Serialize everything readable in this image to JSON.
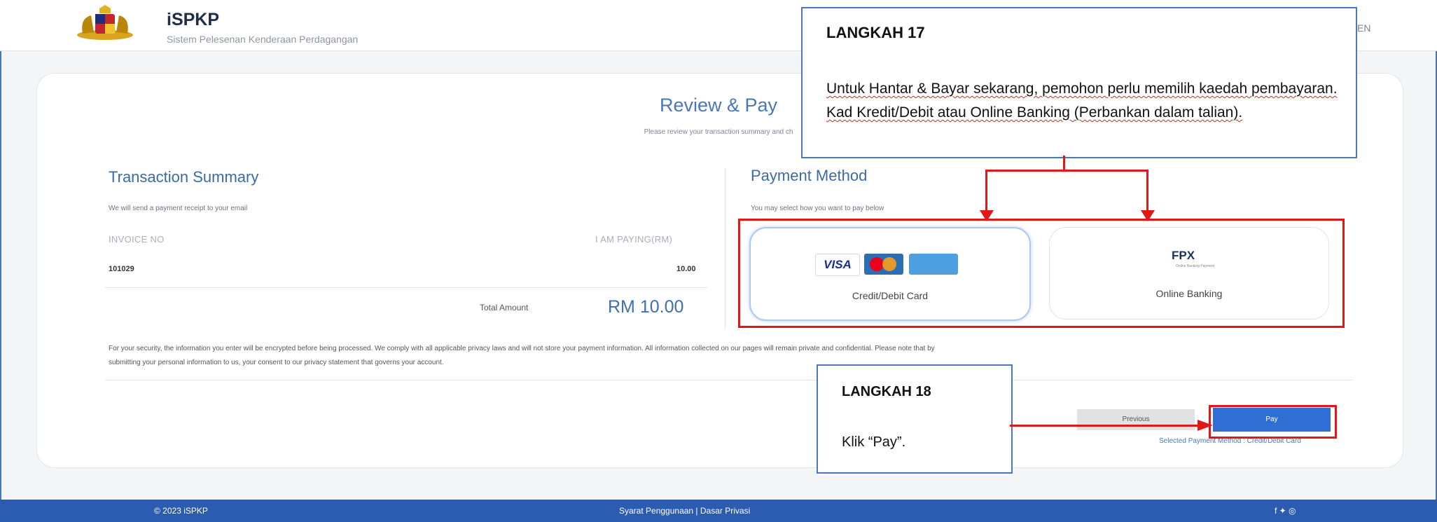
{
  "header": {
    "brand": "iSPKP",
    "subtitle": "Sistem Pelesenan Kenderaan Perdagangan",
    "lang": "EN"
  },
  "review": {
    "title": "Review & Pay",
    "subtitle": "Please review your transaction summary and ch"
  },
  "summary": {
    "title": "Transaction Summary",
    "note": "We will send a payment receipt to your email",
    "col_invoice": "INVOICE NO",
    "col_paying": "I AM PAYING(RM)",
    "invoice_no": "101029",
    "paying": "10.00",
    "total_label": "Total Amount",
    "total_value": "RM 10.00"
  },
  "payment": {
    "title": "Payment Method",
    "note": "You may select how you want to pay below",
    "options": [
      {
        "label": "Credit/Debit Card",
        "logos": [
          "VISA",
          "Mastercard",
          "American Express"
        ]
      },
      {
        "label": "Online Banking",
        "logo": "FPX",
        "logo_sub": "Online Banking Payment"
      }
    ]
  },
  "disclaimer": {
    "line1": "For your security, the information you enter will be encrypted before being processed. We comply with all applicable privacy laws and will not store your payment information. All information collected on our pages will remain private and confidential. Please note that by",
    "line2": "submitting your personal information to us, your consent to our privacy statement that governs your account."
  },
  "actions": {
    "previous": "Previous",
    "pay": "Pay",
    "selected_method": "Selected Payment Method : Credit/Debit Card"
  },
  "callout17": {
    "title": "LANGKAH 17",
    "body": "Untuk Hantar & Bayar sekarang, pemohon perlu memilih kaedah pembayaran. Kad Kredit/Debit atau Online Banking (Perbankan dalam talian)."
  },
  "callout18": {
    "title": "LANGKAH 18",
    "body": "Klik “Pay”."
  },
  "footer": {
    "copyright": "© 2023 iSPKP",
    "links": "Syarat Penggunaan | Dasar Privasi",
    "social": "f ✦ ◎"
  },
  "colors": {
    "accent": "#4a78b7",
    "footer": "#2b5caf",
    "pay_button": "#2f6fd4",
    "highlight": "#e01818"
  }
}
